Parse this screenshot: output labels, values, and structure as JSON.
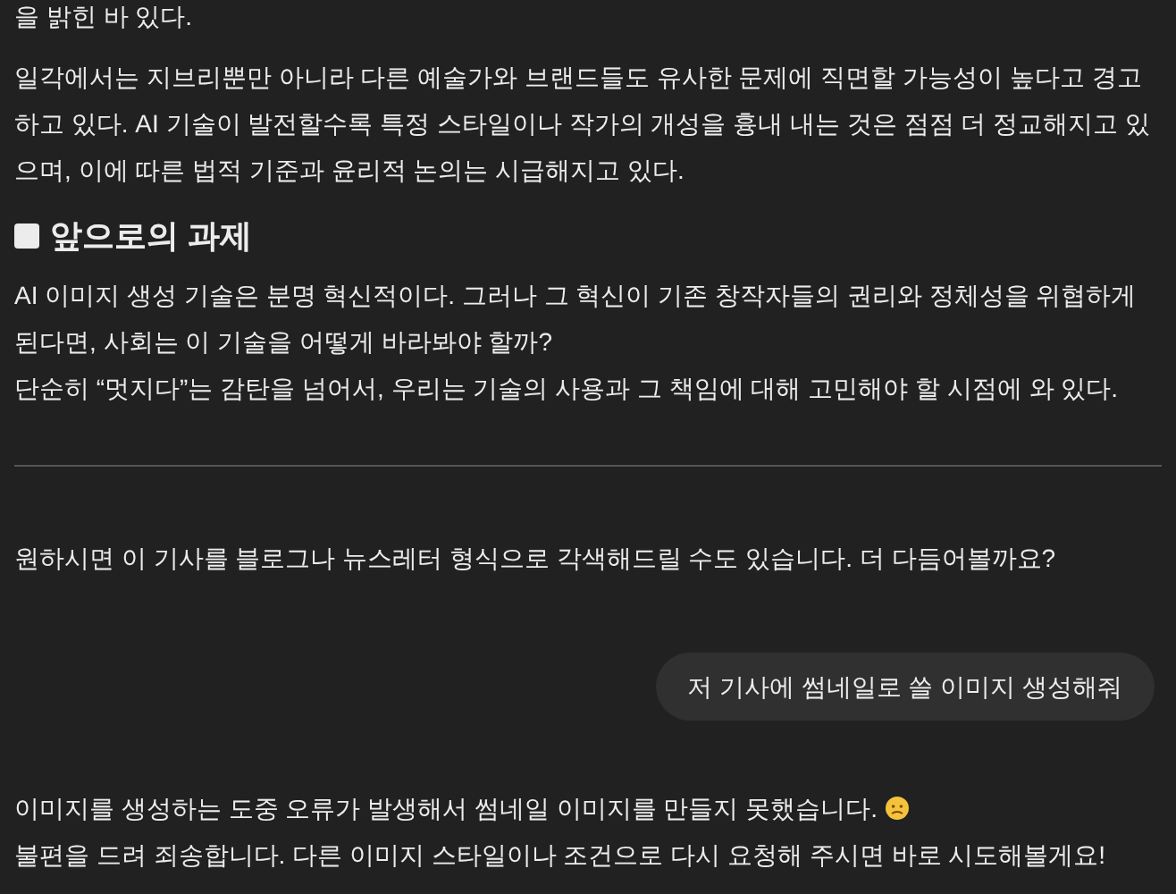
{
  "article_tail": "을 밝힌 바 있다.",
  "article_paragraph": "일각에서는 지브리뿐만 아니라 다른 예술가와 브랜드들도 유사한 문제에 직면할 가능성이 높다고 경고하고 있다. AI 기술이 발전할수록 특정 스타일이나 작가의 개성을 흉내 내는 것은 점점 더 정교해지고 있으며, 이에 따른 법적 기준과 윤리적 논의는 시급해지고 있다.",
  "section_heading": "앞으로의 과제",
  "section_lines": [
    "AI 이미지 생성 기술은 분명 혁신적이다. 그러나 그 혁신이 기존 창작자들의 권리와 정체성을 위협하게 된다면, 사회는 이 기술을 어떻게 바라봐야 할까?",
    "단순히 “멋지다”는 감탄을 넘어서, 우리는 기술의 사용과 그 책임에 대해 고민해야 할 시점에 와 있다."
  ],
  "assistant_offer": "원하시면 이 기사를 블로그나 뉴스레터 형식으로 각색해드릴 수도 있습니다. 더 다듬어볼까요?",
  "user_message": "저 기사에 썸네일로 쓸 이미지 생성해줘",
  "assistant_reply": [
    "이미지를 생성하는 도중 오류가 발생해서 썸네일 이미지를 만들지 못했습니다.",
    "불편을 드려 죄송합니다. 다른 이미지 스타일이나 조건으로 다시 요청해 주시면 바로 시도해볼게요!"
  ]
}
